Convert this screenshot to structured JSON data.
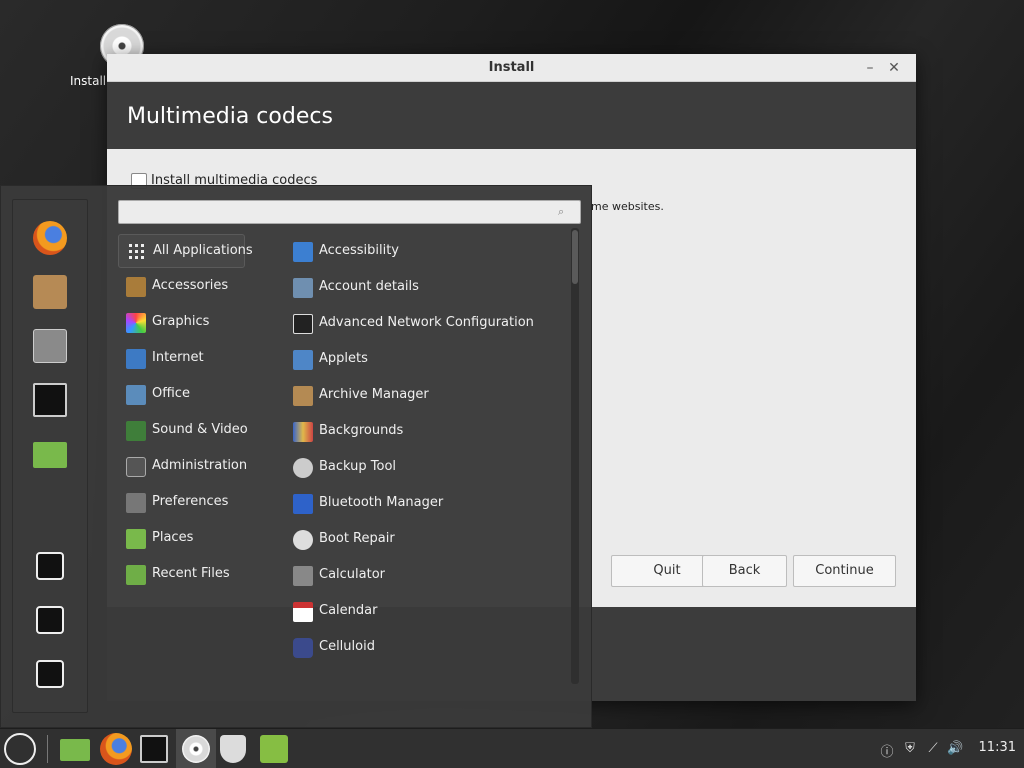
{
  "desktop": {
    "icon_label": "Install"
  },
  "window": {
    "title": "Install",
    "min_glyph": "–",
    "close_glyph": "✕",
    "header_title": "Multimedia codecs",
    "checkbox_label": "Install multimedia codecs",
    "description_fragment": "me websites.",
    "buttons": {
      "quit": "Quit",
      "back": "Back",
      "continue": "Continue"
    }
  },
  "menu": {
    "search_placeholder": "",
    "categories": [
      {
        "label": "All Applications",
        "icon": "grid-icon",
        "active": true
      },
      {
        "label": "Accessories",
        "icon": "accessories-icon"
      },
      {
        "label": "Graphics",
        "icon": "graphics-icon"
      },
      {
        "label": "Internet",
        "icon": "internet-icon"
      },
      {
        "label": "Office",
        "icon": "office-icon"
      },
      {
        "label": "Sound & Video",
        "icon": "sound-video-icon"
      },
      {
        "label": "Administration",
        "icon": "administration-icon"
      },
      {
        "label": "Preferences",
        "icon": "preferences-icon"
      },
      {
        "label": "Places",
        "icon": "places-folder-icon"
      },
      {
        "label": "Recent Files",
        "icon": "recent-files-icon"
      }
    ],
    "applications": [
      {
        "label": "Accessibility",
        "icon": "accessibility-icon"
      },
      {
        "label": "Account details",
        "icon": "account-icon"
      },
      {
        "label": "Advanced Network Configuration",
        "icon": "network-config-icon"
      },
      {
        "label": "Applets",
        "icon": "applets-icon"
      },
      {
        "label": "Archive Manager",
        "icon": "archive-icon"
      },
      {
        "label": "Backgrounds",
        "icon": "backgrounds-icon"
      },
      {
        "label": "Backup Tool",
        "icon": "backup-icon"
      },
      {
        "label": "Bluetooth Manager",
        "icon": "bluetooth-icon"
      },
      {
        "label": "Boot Repair",
        "icon": "boot-repair-icon"
      },
      {
        "label": "Calculator",
        "icon": "calculator-icon"
      },
      {
        "label": "Calendar",
        "icon": "calendar-icon"
      },
      {
        "label": "Celluloid",
        "icon": "celluloid-icon"
      }
    ],
    "favorites": [
      "firefox-icon",
      "software-manager-icon",
      "settings-icon",
      "terminal-icon",
      "files-folder-icon"
    ],
    "session": [
      "lock-screen-icon",
      "logout-icon",
      "power-icon"
    ]
  },
  "panel": {
    "launchers": [
      "files-folder-icon",
      "firefox-icon",
      "terminal-icon",
      "install-disc-icon",
      "shield-icon",
      "mint-update-icon"
    ],
    "tray": [
      "info-icon",
      "shield-tray-icon",
      "network-icon",
      "volume-icon"
    ],
    "clock": "11:31"
  }
}
